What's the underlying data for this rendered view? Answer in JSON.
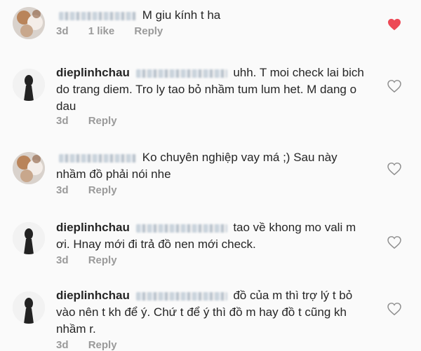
{
  "comments": [
    {
      "username": "",
      "text": "M giu kính t ha",
      "time": "3d",
      "likes": "1 like",
      "reply": "Reply",
      "liked": true,
      "avatar": "flower-avatar"
    },
    {
      "username": "dieplinhchau",
      "line1": "uhh. T moi check lai",
      "rest": "bich do trang diem. Tro ly tao bỏ nhầm tum lum het. M dang o dau",
      "time": "3d",
      "reply": "Reply",
      "liked": false,
      "avatar": "silhouette-avatar"
    },
    {
      "username": "",
      "line1": "Ko chuyên nghiệp vay má ;) Sau này",
      "rest": "nhầm đồ phải nói nhe",
      "time": "3d",
      "reply": "Reply",
      "liked": false,
      "avatar": "flower-avatar"
    },
    {
      "username": "dieplinhchau",
      "line1": "tao về khong mo vali m",
      "rest": "ơi. Hnay mới đi trả đồ nen mới check.",
      "time": "3d",
      "reply": "Reply",
      "liked": false,
      "avatar": "silhouette-avatar"
    },
    {
      "username": "dieplinhchau",
      "line1": "đồ của m thì trợ lý t bỏ",
      "rest": "vào nên t kh để ý. Chứ t để ý thì đồ m hay đồ t cũng kh nhầm r.",
      "time": "3d",
      "reply": "Reply",
      "liked": false,
      "avatar": "silhouette-avatar"
    }
  ],
  "colors": {
    "liked_heart": "#ed4956",
    "meta_text": "#9a9a9a",
    "text": "#262626"
  }
}
